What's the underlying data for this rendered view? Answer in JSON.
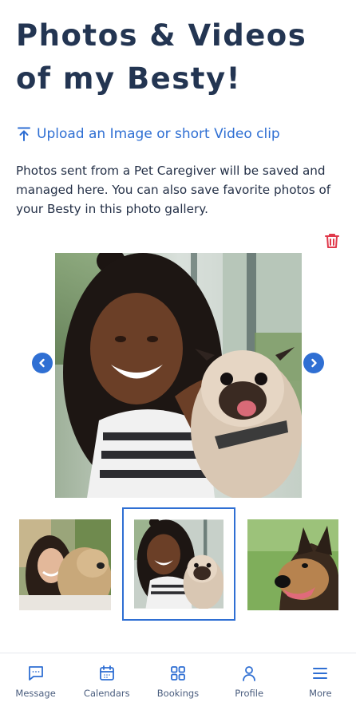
{
  "header": {
    "title_line1": "Photos & Videos",
    "title_line2": "of my Besty!"
  },
  "upload": {
    "label": "Upload an Image or short Video clip",
    "icon": "upload-icon"
  },
  "description": "Photos sent from a Pet Caregiver will be saved and managed here. You can also save favorite photos of your Besty in this photo gallery.",
  "gallery": {
    "delete_icon": "trash-icon",
    "prev_icon": "chevron-left-icon",
    "next_icon": "chevron-right-icon",
    "selected_index": 1,
    "thumbnails": [
      "woman-with-terrier",
      "woman-with-pug",
      "german-shepherd"
    ]
  },
  "bottom_nav": {
    "items": [
      {
        "label": "Message",
        "icon": "message-icon"
      },
      {
        "label": "Calendars",
        "icon": "calendar-icon"
      },
      {
        "label": "Bookings",
        "icon": "grid-icon"
      },
      {
        "label": "Profile",
        "icon": "person-icon"
      },
      {
        "label": "More",
        "icon": "menu-icon"
      }
    ]
  },
  "colors": {
    "accent": "#2f6fd3",
    "title": "#233552",
    "danger": "#e0394b",
    "nav_text": "#4a5d7e"
  }
}
